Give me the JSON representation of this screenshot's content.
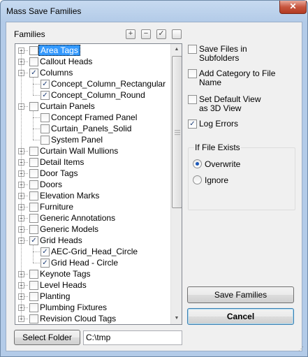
{
  "window": {
    "title": "Mass Save Families",
    "close_glyph": "✕"
  },
  "families": {
    "label": "Families",
    "toolbar": {
      "expand_glyph": "+",
      "collapse_glyph": "−",
      "check_glyph": "✓",
      "uncheck_glyph": ""
    },
    "tree": [
      {
        "label": "Area Tags",
        "level": 0,
        "expander": "+",
        "checked": false,
        "selected": true
      },
      {
        "label": "Callout Heads",
        "level": 0,
        "expander": "+",
        "checked": false,
        "selected": false
      },
      {
        "label": "Columns",
        "level": 0,
        "expander": "−",
        "checked": true,
        "selected": false
      },
      {
        "label": "Concept_Column_Rectangular",
        "level": 1,
        "expander": "",
        "checked": true,
        "selected": false
      },
      {
        "label": "Concept_Column_Round",
        "level": 1,
        "expander": "",
        "checked": true,
        "selected": false
      },
      {
        "label": "Curtain Panels",
        "level": 0,
        "expander": "−",
        "checked": false,
        "selected": false
      },
      {
        "label": "Concept Framed Panel",
        "level": 1,
        "expander": "",
        "checked": false,
        "selected": false
      },
      {
        "label": "Curtain_Panels_Solid",
        "level": 1,
        "expander": "",
        "checked": false,
        "selected": false
      },
      {
        "label": "System Panel",
        "level": 1,
        "expander": "",
        "checked": false,
        "selected": false
      },
      {
        "label": "Curtain Wall Mullions",
        "level": 0,
        "expander": "+",
        "checked": false,
        "selected": false
      },
      {
        "label": "Detail Items",
        "level": 0,
        "expander": "+",
        "checked": false,
        "selected": false
      },
      {
        "label": "Door Tags",
        "level": 0,
        "expander": "+",
        "checked": false,
        "selected": false
      },
      {
        "label": "Doors",
        "level": 0,
        "expander": "+",
        "checked": false,
        "selected": false
      },
      {
        "label": "Elevation Marks",
        "level": 0,
        "expander": "+",
        "checked": false,
        "selected": false
      },
      {
        "label": "Furniture",
        "level": 0,
        "expander": "+",
        "checked": false,
        "selected": false
      },
      {
        "label": "Generic Annotations",
        "level": 0,
        "expander": "+",
        "checked": false,
        "selected": false
      },
      {
        "label": "Generic Models",
        "level": 0,
        "expander": "+",
        "checked": false,
        "selected": false
      },
      {
        "label": "Grid Heads",
        "level": 0,
        "expander": "−",
        "checked": true,
        "selected": false
      },
      {
        "label": "AEC-Grid_Head_Circle",
        "level": 1,
        "expander": "",
        "checked": true,
        "selected": false
      },
      {
        "label": "Grid Head - Circle",
        "level": 1,
        "expander": "",
        "checked": true,
        "selected": false
      },
      {
        "label": "Keynote Tags",
        "level": 0,
        "expander": "+",
        "checked": false,
        "selected": false
      },
      {
        "label": "Level Heads",
        "level": 0,
        "expander": "+",
        "checked": false,
        "selected": false
      },
      {
        "label": "Planting",
        "level": 0,
        "expander": "+",
        "checked": false,
        "selected": false
      },
      {
        "label": "Plumbing Fixtures",
        "level": 0,
        "expander": "+",
        "checked": false,
        "selected": false
      },
      {
        "label": "Revision Cloud Tags",
        "level": 0,
        "expander": "+",
        "checked": false,
        "selected": false
      }
    ],
    "scroll_up_glyph": "▲",
    "scroll_down_glyph": "▼"
  },
  "options": {
    "save_in_subfolders": {
      "line1": "Save Files in",
      "line2": "Subfolders",
      "checked": false
    },
    "add_category": {
      "line1": "Add Category to File",
      "line2": "Name",
      "checked": false
    },
    "default_view": {
      "line1": "Set Default View",
      "line2": "as 3D View",
      "checked": false
    },
    "log_errors": {
      "line1": "Log Errors",
      "checked": true
    }
  },
  "if_exists": {
    "title": "If File Exists",
    "overwrite": "Overwrite",
    "ignore": "Ignore",
    "selected": "overwrite"
  },
  "buttons": {
    "save": "Save Families",
    "cancel": "Cancel",
    "select_folder": "Select Folder"
  },
  "folder": {
    "value": "C:\\tmp"
  }
}
